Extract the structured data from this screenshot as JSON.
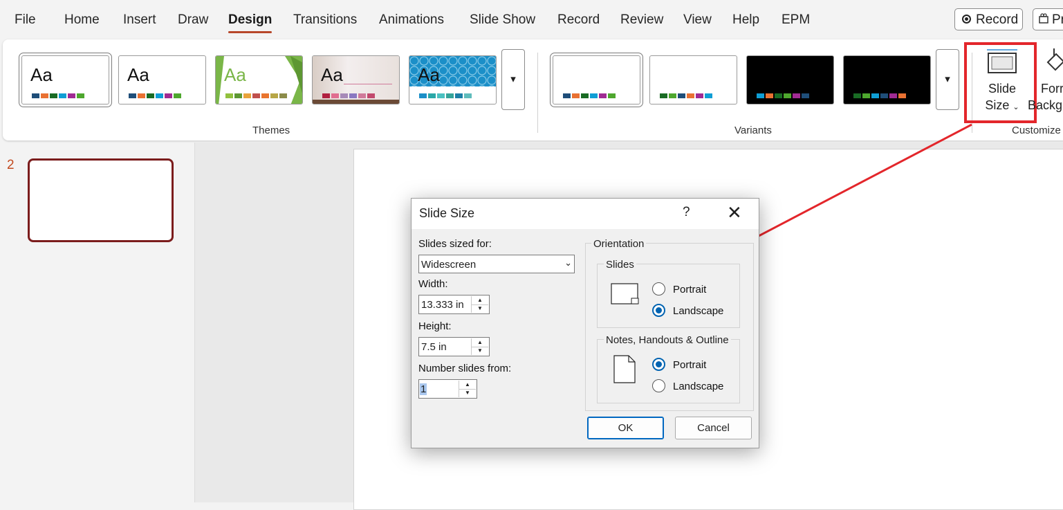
{
  "menu": {
    "tabs": [
      "File",
      "Home",
      "Insert",
      "Draw",
      "Design",
      "Transitions",
      "Animations",
      "Slide Show",
      "Record",
      "Review",
      "View",
      "Help",
      "EPM"
    ],
    "active_tab": "Design",
    "record_button": "Record",
    "present_button": "Pr"
  },
  "ribbon": {
    "themes": [
      {
        "label": "Aa",
        "bg": "#ffffff",
        "text_color": "#111111",
        "swatches": [
          "#1f4e79",
          "#e97132",
          "#196b24",
          "#0f9ed5",
          "#a02b93",
          "#4ea72e"
        ]
      },
      {
        "label": "Aa",
        "bg": "#ffffff",
        "text_color": "#111111",
        "swatches": [
          "#1f4e79",
          "#e97132",
          "#196b24",
          "#0f9ed5",
          "#a02b93",
          "#4ea72e"
        ]
      },
      {
        "label": "Aa",
        "bg": "#ffffff",
        "text_color": "#7ab648",
        "swatches": [
          "#92c13e",
          "#5d9732",
          "#e8a33b",
          "#c0504d",
          "#e9752f",
          "#b7a647",
          "#8c8c4a"
        ]
      },
      {
        "label": "Aa",
        "bg": "#f5eded",
        "text_color": "#111111",
        "swatches": [
          "#b01f3f",
          "#e06d8f",
          "#a78ab8",
          "#8a78c1",
          "#d07a9a",
          "#c24a6e"
        ]
      },
      {
        "label": "Aa",
        "bg": "#ffffff",
        "text_color": "#111111",
        "swatches": [
          "#1b8fc8",
          "#2aa8a8",
          "#4bc1c1",
          "#34a49a",
          "#1c7fa6",
          "#5fbcbc"
        ]
      }
    ],
    "themes_label": "Themes",
    "variants": [
      {
        "bg": "#ffffff",
        "swatches": [
          "#1f4e79",
          "#e97132",
          "#196b24",
          "#0f9ed5",
          "#a02b93",
          "#4ea72e"
        ]
      },
      {
        "bg": "#ffffff",
        "swatches": [
          "#196b24",
          "#4ea72e",
          "#1f4e79",
          "#e97132",
          "#a02b93",
          "#0f9ed5"
        ]
      },
      {
        "bg": "#000000",
        "swatches": [
          "#0f9ed5",
          "#e97132",
          "#196b24",
          "#4ea72e",
          "#a02b93",
          "#1f4e79"
        ]
      },
      {
        "bg": "#000000",
        "swatches": [
          "#196b24",
          "#4ea72e",
          "#0f9ed5",
          "#1f4e79",
          "#a02b93",
          "#e97132"
        ]
      }
    ],
    "variants_label": "Variants",
    "slide_size_line1": "Slide",
    "slide_size_line2": "Size",
    "format_bg_line1": "Forr",
    "format_bg_line2": "Backgr",
    "customize_label": "Customize"
  },
  "slides_pane": {
    "slide_number": "2"
  },
  "dialog": {
    "title": "Slide Size",
    "help": "?",
    "close": "✕",
    "slides_sized_for_label": "Slides sized for:",
    "slides_sized_for_value": "Widescreen",
    "width_label": "Width:",
    "width_value": "13.333 in",
    "height_label": "Height:",
    "height_value": "7.5 in",
    "number_slides_from_label": "Number slides from:",
    "number_slides_from_value": "1",
    "orientation_label": "Orientation",
    "slides_group_label": "Slides",
    "slides_portrait": "Portrait",
    "slides_landscape": "Landscape",
    "slides_selected": "Landscape",
    "notes_group_label": "Notes, Handouts & Outline",
    "notes_portrait": "Portrait",
    "notes_landscape": "Landscape",
    "notes_selected": "Portrait",
    "ok": "OK",
    "cancel": "Cancel"
  },
  "annotation": {
    "color": "#e3262b"
  }
}
